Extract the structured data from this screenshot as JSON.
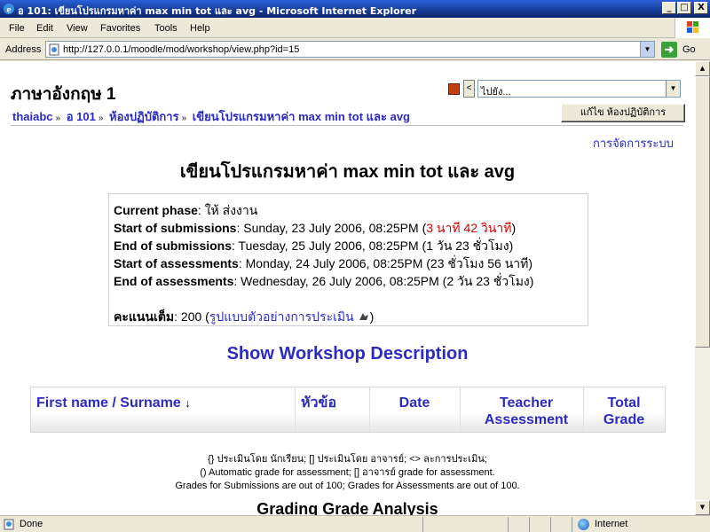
{
  "window": {
    "title": "อ 101: เขียนโปรแกรมหาค่า max min tot และ avg - Microsoft Internet Explorer",
    "buttons": {
      "minimize": "_",
      "maximize": "□",
      "close": "X"
    }
  },
  "menubar": {
    "items": [
      "File",
      "Edit",
      "View",
      "Favorites",
      "Tools",
      "Help"
    ]
  },
  "addressbar": {
    "label": "Address",
    "url": "http://127.0.0.1/moodle/mod/workshop/view.php?id=15",
    "go_label": "Go"
  },
  "header": {
    "course_title": "ภาษาอังกฤษ 1",
    "jump_to": "ไปยัง...",
    "breadcrumb": [
      "thaiabc",
      "อ 101",
      "ห้องปฏิบัติการ",
      "เขียนโปรแกรมหาค่า max min tot และ avg"
    ],
    "update_button": "แก้ไข ห้องปฏิบัติการ",
    "admin_link": "การจัดการระบบ"
  },
  "main": {
    "title": "เขียนโปรแกรมหาค่า max min tot และ avg",
    "info": {
      "current_phase_label": "Current phase",
      "current_phase_value": ": ให้ ส่งงาน",
      "start_sub_label": "Start of submissions",
      "start_sub_value": ": Sunday, 23 July 2006, 08:25PM (",
      "start_sub_remaining": "3 นาที 42 วินาที",
      "start_sub_close": ")",
      "end_sub_label": "End of submissions",
      "end_sub_value": ": Tuesday, 25 July 2006, 08:25PM (1 วัน 23 ชั่วโมง)",
      "start_ass_label": "Start of assessments",
      "start_ass_value": ": Monday, 24 July 2006, 08:25PM (23 ชั่วโมง 56 นาที)",
      "end_ass_label": "End of assessments",
      "end_ass_value": ": Wednesday, 26 July 2006, 08:25PM (2 วัน 23 ชั่วโมง)",
      "max_grade_label": "คะแนนเต็ม",
      "max_grade_value": ": 200 (",
      "max_grade_link": "รูปแบบตัวอย่างการประเมิน",
      "max_grade_close": ")"
    },
    "show_description": "Show Workshop Description",
    "table": {
      "first_name": "First name",
      "slash": " / ",
      "surname": "Surname",
      "sort_arrow": "↓",
      "topic": "หัวข้อ",
      "date": "Date",
      "teacher_assessment": "Teacher Assessment",
      "total_grade": "Total Grade"
    },
    "legend": {
      "line1": "{} ประเมินโดย นักเรียน;    [] ประเมินโดย อาจารย์;    <> ละการประเมิน;",
      "line2": "() Automatic grade for assessment;    [] อาจารย์ grade for assessment.",
      "line3": "Grades for Submissions are out of 100;    Grades for Assessments are out of 100."
    },
    "cut_heading": "Grading Grade Analysis"
  },
  "statusbar": {
    "status": "Done",
    "zone": "Internet"
  }
}
